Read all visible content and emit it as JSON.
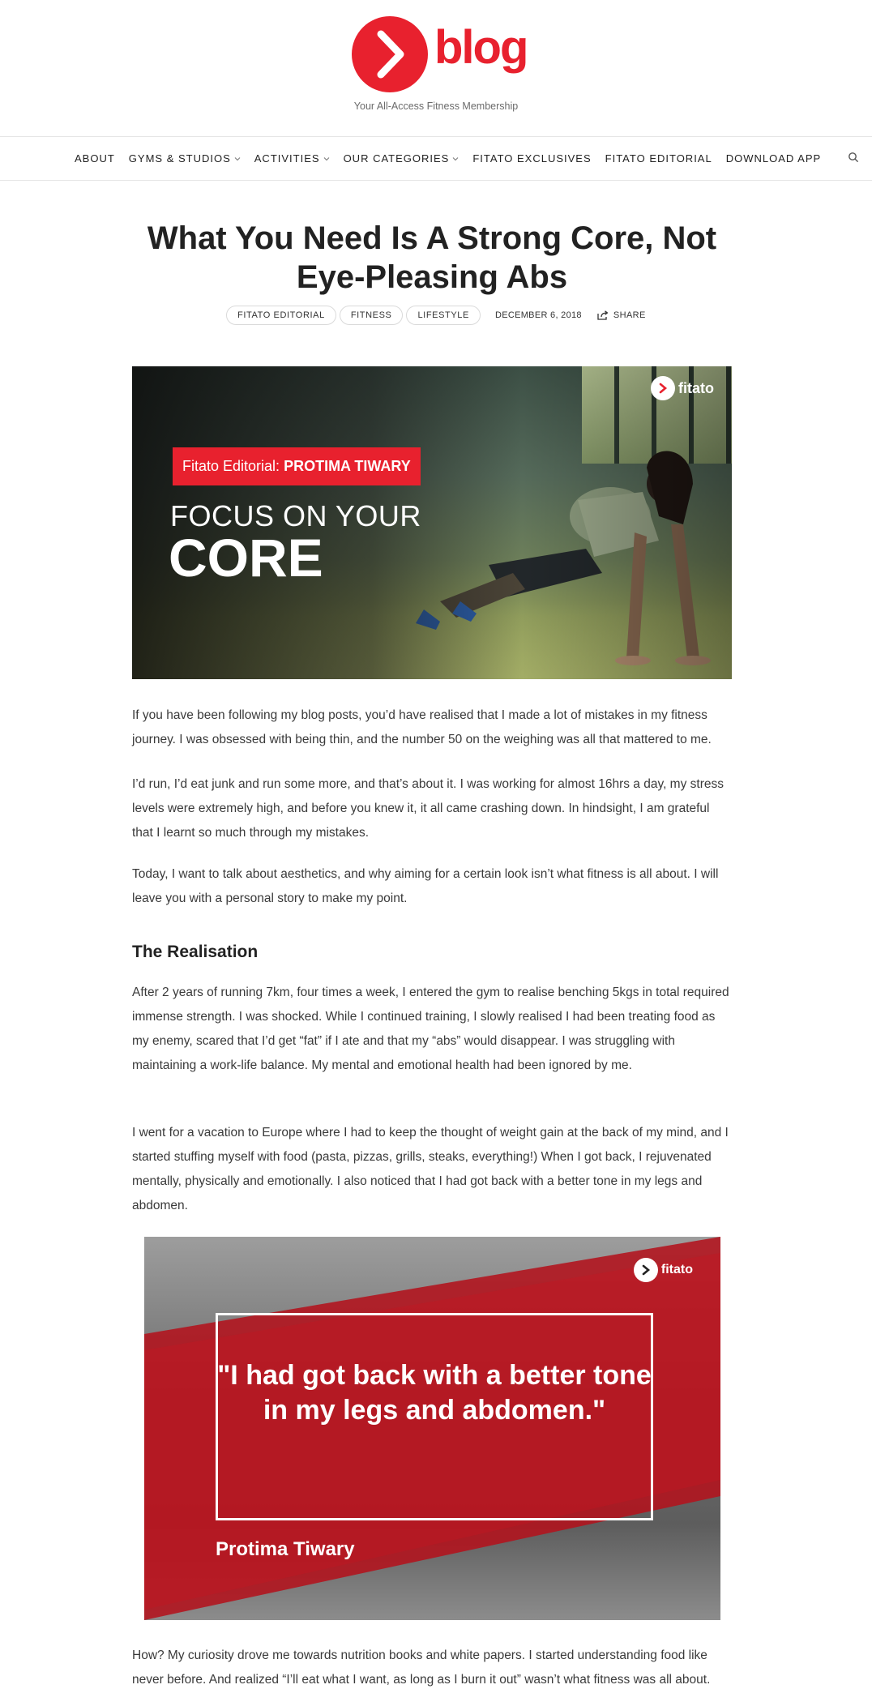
{
  "brand": {
    "logo_text": "blog",
    "tagline": "Your All-Access Fitness Membership",
    "accent": "#e8212e"
  },
  "nav": {
    "items": [
      {
        "label": "ABOUT",
        "dropdown": false
      },
      {
        "label": "GYMS & STUDIOS",
        "dropdown": true
      },
      {
        "label": "ACTIVITIES",
        "dropdown": true
      },
      {
        "label": "OUR CATEGORIES",
        "dropdown": true
      },
      {
        "label": "FITATO EXCLUSIVES",
        "dropdown": false
      },
      {
        "label": "FITATO EDITORIAL",
        "dropdown": false
      },
      {
        "label": "DOWNLOAD APP",
        "dropdown": false
      }
    ],
    "search_icon": "search-icon"
  },
  "article": {
    "title": "What You Need Is A Strong Core, Not Eye-Pleasing Abs",
    "tags": [
      "FITATO EDITORIAL",
      "FITNESS",
      "LIFESTYLE"
    ],
    "date": "DECEMBER 6, 2018",
    "share_label": "SHARE",
    "hero": {
      "brand": "fitato",
      "badge_prefix": "Fitato Editorial:",
      "badge_name": "PROTIMA TIWARY",
      "headline_line1": "FOCUS ON YOUR",
      "headline_line2": "CORE"
    },
    "paragraphs": [
      "If you have been following my blog posts, you’d have realised that I made a lot of mistakes in my fitness journey. I was obsessed with being thin, and the number 50 on the weighing was all that mattered to me.",
      "I’d run, I’d eat junk and run some more, and that’s about it. I was working for almost 16hrs a day, my stress levels were extremely high, and before you knew it, it all came crashing down. In hindsight, I am grateful that I learnt so much through my mistakes.",
      "Today, I want to talk about aesthetics, and why aiming for a certain look isn’t what fitness is all about. I will leave you with a personal story to make my point."
    ],
    "section_heading": "The Realisation",
    "section_paragraphs": [
      "After 2 years of running 7km, four times a week, I entered the gym to realise benching 5kgs in total required immense strength. I was shocked. While I continued training, I slowly realised I had been treating food as my enemy, scared that I’d get “fat” if I ate and that my “abs” would disappear.  I was struggling with maintaining a work-life balance. My mental and emotional health had been ignored by me.",
      "I went for a vacation to Europe where I had to keep the thought of weight gain at the back of my mind, and I started stuffing myself with food (pasta, pizzas, grills, steaks, everything!) When I got back, I rejuvenated mentally, physically and emotionally. I also noticed that I had got back with a better tone in my legs and abdomen."
    ],
    "quote_image": {
      "brand": "fitato",
      "quote": "\"I had got back with a better tone in my legs and abdomen.\"",
      "author": "Protima Tiwary"
    },
    "closing_paragraph": "How? My curiosity drove me towards nutrition books and white papers. I started understanding food like never before. And realized “I’ll eat what I want, as long as I burn it out” wasn’t what fitness was all about."
  }
}
